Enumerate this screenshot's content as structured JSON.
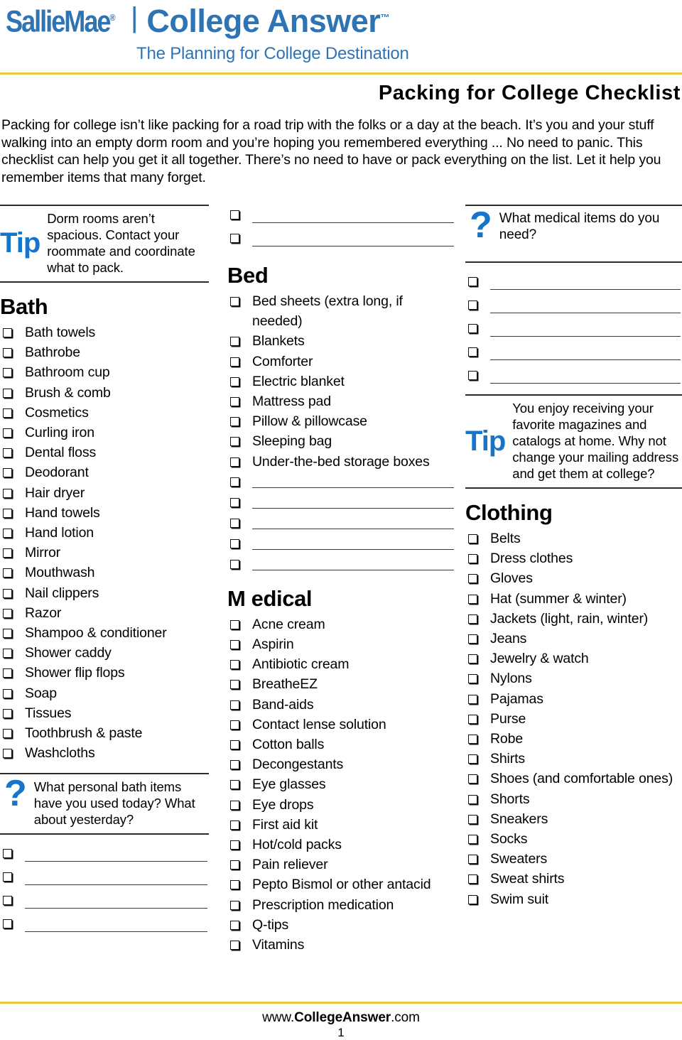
{
  "brand": {
    "logo_primary": "SallieMae",
    "logo_registered": "®",
    "logo_divider": "|",
    "logo_secondary": "College Answer",
    "logo_secondary_tm": "™",
    "tagline": "The Planning for College Destination"
  },
  "page_title": "Packing for College Checklist",
  "intro": "Packing for college isn’t like packing for a road trip with the folks or a day at the beach. It’s you and your stuff walking into an empty dorm room and you’re hoping you remembered everything ... No need to panic. This checklist can help you get it all together. There’s no need to have or pack everything on the list. Let it help you remember items that many forget.",
  "left_column": {
    "tip": {
      "label": "Tip",
      "text": "Dorm rooms aren’t spacious. Contact your roommate and coordinate what to pack."
    },
    "bath": {
      "heading": "Bath",
      "items": [
        "Bath towels",
        "Bathrobe",
        "Bathroom cup",
        "Brush & comb",
        "Cosmetics",
        "Curling iron",
        "Dental floss",
        "Deodorant",
        "Hair dryer",
        "Hand towels",
        "Hand lotion",
        "Mirror",
        "Mouthwash",
        "Nail clippers",
        "Razor",
        "Shampoo & conditioner",
        "Shower caddy",
        "Shower flip flops",
        "Soap",
        "Tissues",
        "Toothbrush & paste",
        "Washcloths"
      ]
    },
    "question": {
      "mark": "?",
      "text": "What personal bath items have you used today? What about yesterday?"
    },
    "blank_lines": 4
  },
  "middle_column": {
    "top_blank_lines": 2,
    "bed": {
      "heading": "Bed",
      "items": [
        "Bed sheets (extra long, if needed)",
        "Blankets",
        "Comforter",
        "Electric blanket",
        "Mattress pad",
        "Pillow & pillowcase",
        "Sleeping bag",
        "Under-the-bed storage boxes"
      ],
      "blank_lines": 5
    },
    "medical": {
      "heading": "M edical",
      "items": [
        "Acne cream",
        "Aspirin",
        "Antibiotic cream",
        "BreatheEZ",
        "Band-aids",
        "Contact lense solution",
        "Cotton balls",
        "Decongestants",
        "Eye glasses",
        "Eye drops",
        "First aid kit",
        "Hot/cold packs",
        "Pain reliever",
        "Pepto Bismol or other antacid",
        "Prescription medication",
        "Q-tips",
        "Vitamins"
      ]
    }
  },
  "right_column": {
    "question": {
      "mark": "?",
      "text": "What medical items do you need?"
    },
    "blank_lines": 5,
    "tip": {
      "label": "Tip",
      "text": "You enjoy receiving your favorite magazines and catalogs at home. Why not change your mailing address and get them at college?"
    },
    "clothing": {
      "heading": "Clothing",
      "items": [
        "Belts",
        "Dress clothes",
        "Gloves",
        "Hat (summer & winter)",
        "Jackets (light, rain, winter)",
        "Jeans",
        "Jewelry & watch",
        "Nylons",
        "Pajamas",
        "Purse",
        "Robe",
        "Shirts",
        "Shoes (and comfortable ones)",
        "Shorts",
        "Sneakers",
        "Socks",
        "Sweaters",
        "Sweat shirts",
        "Swim suit"
      ]
    }
  },
  "footer": {
    "url_prefix": "www.",
    "url_brand": "CollegeAnswer",
    "url_suffix": ".com",
    "page_number": "1"
  },
  "colors": {
    "brand_blue": "#2E74B5",
    "accent_blue": "#1675C8",
    "gold_rule": "#E8C840",
    "text": "#000000"
  }
}
